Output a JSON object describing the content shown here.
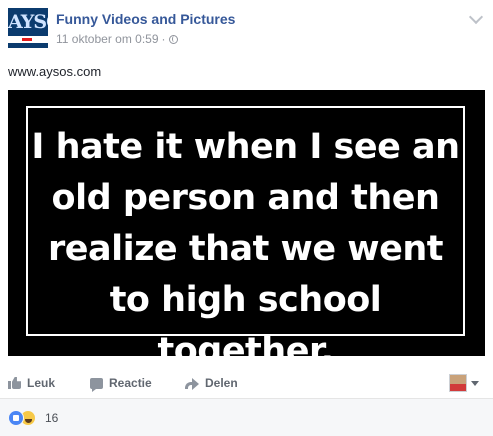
{
  "post": {
    "page_name": "Funny Videos and Pictures",
    "timestamp": "11 oktober om 0:59",
    "separator": "·",
    "text": "www.aysos.com",
    "avatar_logo_text": "AYSOS",
    "image_text": "I hate it when I see an old  person and then realize that we went to high school together."
  },
  "actions": {
    "like_label": "Leuk",
    "comment_label": "Reactie",
    "share_label": "Delen"
  },
  "reactions": {
    "count": "16",
    "icons": [
      "like-reaction-icon",
      "haha-reaction-icon"
    ]
  },
  "colors": {
    "link_blue": "#365899",
    "meta_gray": "#90949c",
    "action_gray": "#616770",
    "image_bg": "#000000"
  }
}
